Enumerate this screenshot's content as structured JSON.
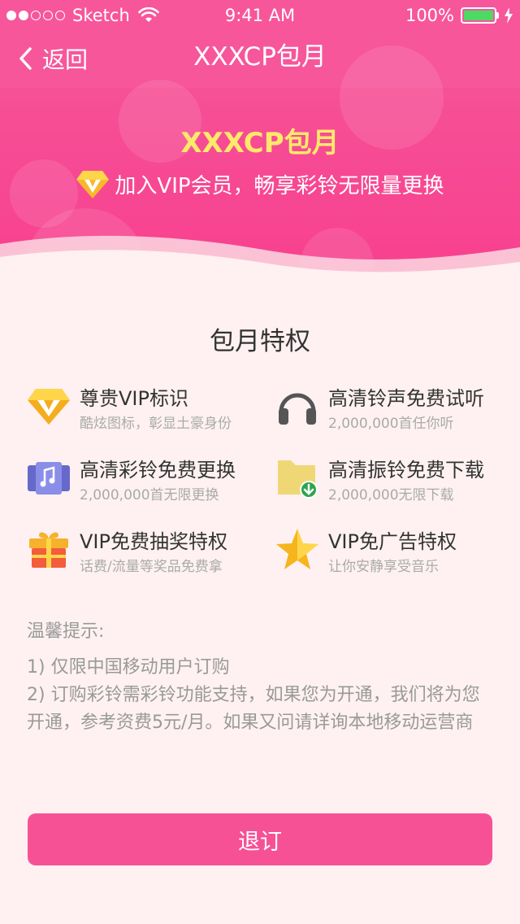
{
  "status_bar": {
    "carrier": "Sketch",
    "time": "9:41 AM",
    "battery_percent": "100%",
    "battery_level": 1.0,
    "signal_filled": 2,
    "signal_total": 5
  },
  "nav": {
    "back_label": "返回",
    "title": "XXXCP包月"
  },
  "hero": {
    "title": "XXXCP包月",
    "subtitle": "加入VIP会员，畅享彩铃无限量更换"
  },
  "privileges": {
    "title": "包月特权",
    "items": [
      {
        "icon": "vip-diamond-icon",
        "title": "尊贵VIP标识",
        "desc": "酷炫图标，彰显土豪身份"
      },
      {
        "icon": "headphones-icon",
        "title": "高清铃声免费试听",
        "desc": "2,000,000首任你听"
      },
      {
        "icon": "music-note-icon",
        "title": "高清彩铃免费更换",
        "desc": "2,000,000首无限更换"
      },
      {
        "icon": "download-folder-icon",
        "title": "高清振铃免费下载",
        "desc": "2,000,000无限下载"
      },
      {
        "icon": "gift-box-icon",
        "title": "VIP免费抽奖特权",
        "desc": "话费/流量等奖品免费拿"
      },
      {
        "icon": "star-icon",
        "title": "VIP免广告特权",
        "desc": "让你安静享受音乐"
      }
    ]
  },
  "tips": {
    "title": "温馨提示:",
    "lines": [
      "1) 仅限中国移动用户订购",
      "2) 订购彩铃需彩铃功能支持，如果您为开通，我们将为您开通，参考资费5元/月。如果又问请详询本地移动运营商"
    ]
  },
  "action": {
    "unsubscribe_label": "退订"
  },
  "colors": {
    "header_pink": "#f8408f",
    "hero_title_yellow": "#ffe96a",
    "page_background": "#fff1f1",
    "button_pink": "#f75196"
  }
}
